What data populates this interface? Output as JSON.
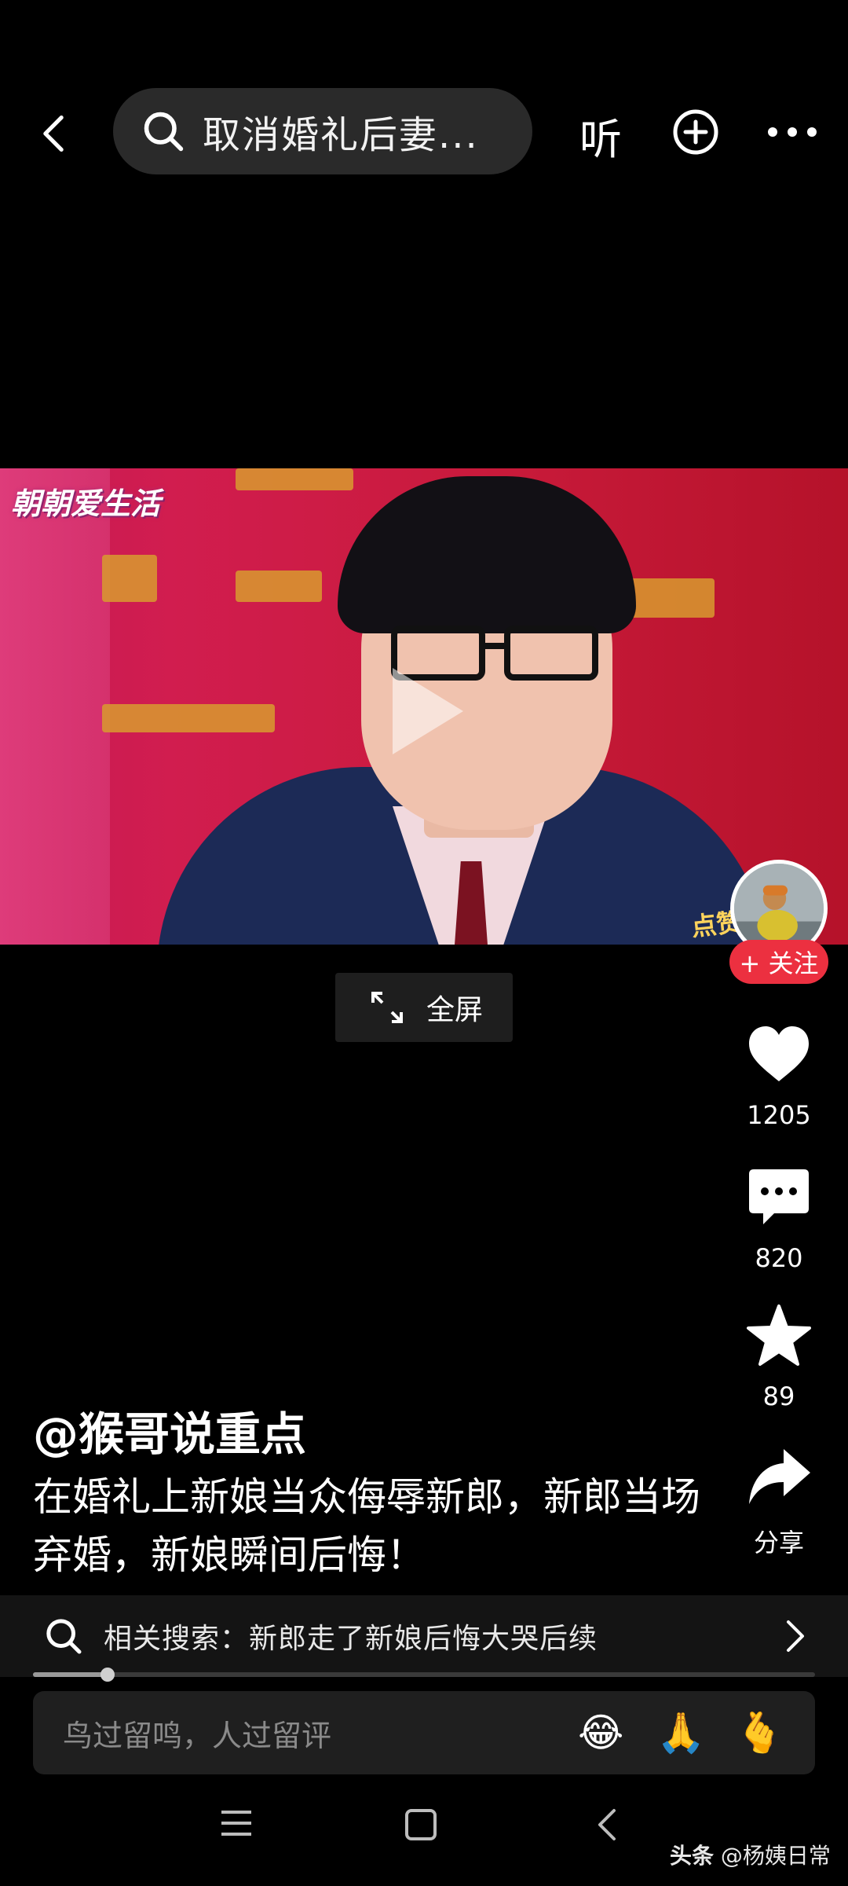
{
  "topbar": {
    "search_text": "取消婚礼后妻...",
    "listen_label": "听"
  },
  "video": {
    "watermark": "朝朝爱生活",
    "sticker": "点赞 · 收"
  },
  "fullscreen_label": "全屏",
  "rail": {
    "follow_label": "+ 关注",
    "like_count": "1205",
    "comment_count": "820",
    "favorite_count": "89",
    "share_label": "分享"
  },
  "post": {
    "author": "@猴哥说重点",
    "description": "在婚礼上新娘当众侮辱新郎，新郎当场弃婚，新娘瞬间后悔！"
  },
  "related_search": "相关搜索：新郎走了新娘后悔大哭后续",
  "progress": {
    "fraction": 0.095
  },
  "comment": {
    "placeholder": "鸟过留鸣，人过留评",
    "emojis": [
      "😂",
      "🙏",
      "🫰"
    ]
  },
  "source_label": {
    "brand": "头条",
    "user": "@杨姨日常"
  },
  "colors": {
    "follow": "#ec3040",
    "background": "#000000",
    "search_pill": "#2a2a2a"
  }
}
